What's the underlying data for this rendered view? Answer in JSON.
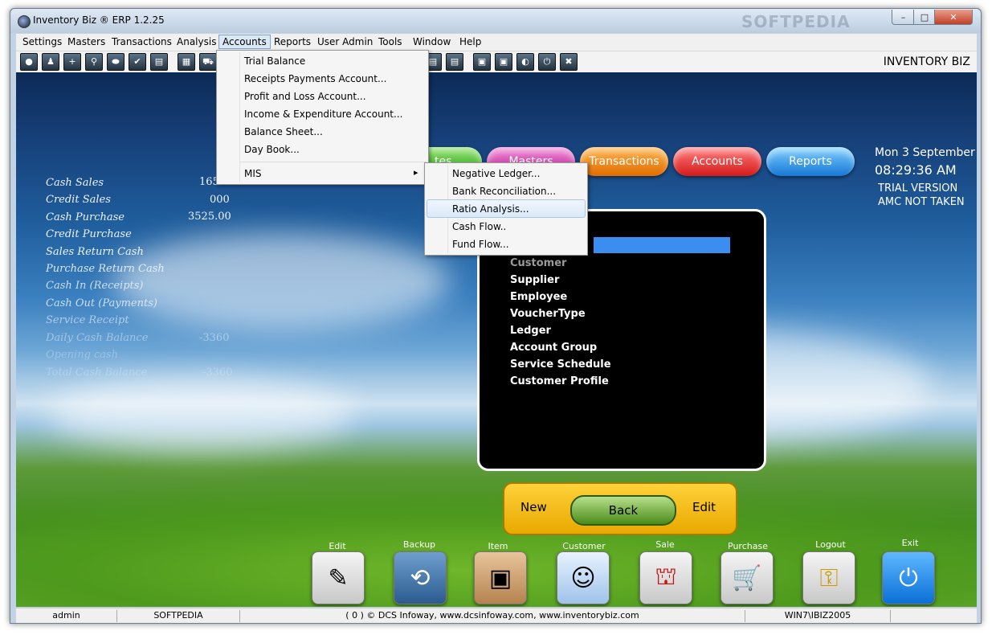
{
  "window": {
    "title": "Inventory Biz ®  ERP 1.2.25",
    "watermark": "SOFTPEDIA",
    "min_glyph": "–",
    "max_glyph": "□",
    "close_glyph": "✕"
  },
  "menubar": [
    "Settings",
    "Masters",
    "Transactions",
    "Analysis",
    "Accounts",
    "Reports",
    "User Admin",
    "Tools",
    "Window",
    "Help"
  ],
  "toolbar": {
    "brand": "INVENTORY BIZ",
    "icons": [
      "●",
      "♟",
      "+",
      "⚲",
      "⬬",
      "✔",
      "▤",
      "▦",
      "⛟",
      "◐",
      "▣",
      "⏻",
      "✖"
    ]
  },
  "left_panel": [
    {
      "label": "Cash Sales",
      "value": "165.0"
    },
    {
      "label": "Credit Sales",
      "value": "000"
    },
    {
      "label": "Cash Purchase",
      "value": "3525.00"
    },
    {
      "label": "Credit Purchase",
      "value": ""
    },
    {
      "label": "Sales Return Cash",
      "value": ""
    },
    {
      "label": "Purchase Return Cash",
      "value": ""
    },
    {
      "label": "Cash In (Receipts)",
      "value": ""
    },
    {
      "label": "Cash Out (Payments)",
      "value": ""
    },
    {
      "label": "Service Receipt",
      "value": ""
    },
    {
      "label": "Daily Cash Balance",
      "value": "-3360"
    },
    {
      "label": "Opening cash",
      "value": ""
    },
    {
      "label": "Total Cash Balance",
      "value": "-3360"
    }
  ],
  "top_buttons": [
    "...tes",
    "Masters",
    "Transactions",
    "Accounts",
    "Reports"
  ],
  "clock": {
    "date": "Mon 3 September",
    "time": "08:29:36 AM",
    "trial": "TRIAL VERSION",
    "amc": "AMC NOT TAKEN"
  },
  "masters_list": [
    "Customer",
    "Supplier",
    "Employee",
    "VoucherType",
    "Ledger",
    "Account Group",
    "Service Schedule",
    "Customer Profile"
  ],
  "nav": {
    "new": "New",
    "back": "Back",
    "edit": "Edit"
  },
  "bottom_icons": [
    {
      "label": "Edit",
      "glyph": "✎"
    },
    {
      "label": "Backup",
      "glyph": "⟲"
    },
    {
      "label": "Item",
      "glyph": "▣"
    },
    {
      "label": "Customer",
      "glyph": "☺"
    },
    {
      "label": "Sale",
      "glyph": "⛫"
    },
    {
      "label": "Purchase",
      "glyph": "🛒"
    },
    {
      "label": "Logout",
      "glyph": "⚿"
    },
    {
      "label": "Exit",
      "glyph": "⏻"
    }
  ],
  "status": {
    "user": "admin",
    "company": "SOFTPEDIA",
    "copyright": "( 0 ) © DCS Infoway, www.dcsinfoway.com, www.inventorybiz.com",
    "machine": "WIN7\\IBIZ2005"
  },
  "accounts_menu": [
    "Trial Balance",
    "Receipts  Payments Account...",
    "Profit and Loss Account...",
    "Income & Expenditure Account...",
    "Balance Sheet...",
    "Day Book...",
    "MIS"
  ],
  "mis_arrow": "▸",
  "mis_menu": [
    "Negative Ledger...",
    "Bank Reconciliation...",
    "Ratio Analysis...",
    "Cash Flow..",
    "Fund Flow..."
  ],
  "accent": {
    "highlight": "#3c8df0",
    "menu_hover": "#dbe9f9"
  }
}
